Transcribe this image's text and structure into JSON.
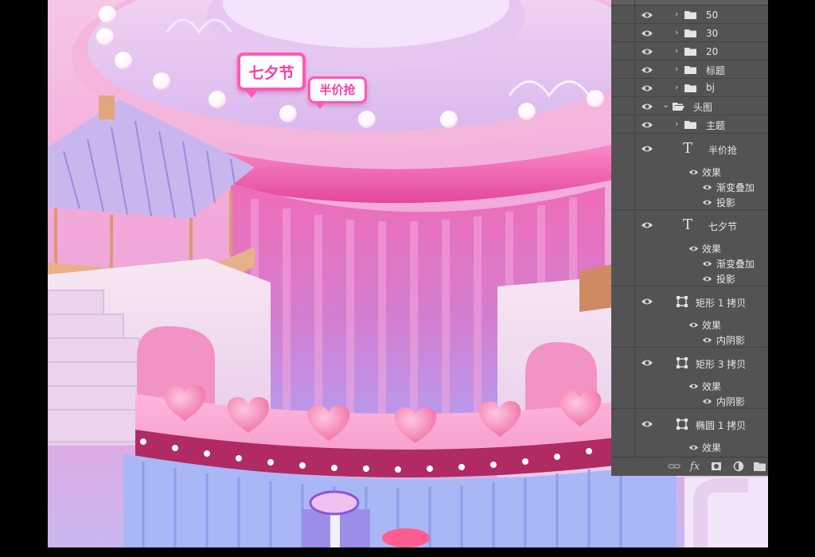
{
  "artwork": {
    "badge_qixi": "七夕节",
    "badge_half_price": "半价抢"
  },
  "layers_panel": {
    "layers": [
      {
        "name": "50",
        "kind": "group",
        "visible": true,
        "collapsed": true
      },
      {
        "name": "30",
        "kind": "group",
        "visible": true,
        "collapsed": true
      },
      {
        "name": "20",
        "kind": "group",
        "visible": true,
        "collapsed": true
      },
      {
        "name": "标题",
        "kind": "group",
        "visible": true,
        "collapsed": true
      },
      {
        "name": "bj",
        "kind": "group",
        "visible": true,
        "collapsed": true
      },
      {
        "name": "头图",
        "kind": "group",
        "visible": true,
        "collapsed": false
      },
      {
        "name": "主题",
        "kind": "group",
        "visible": true,
        "collapsed": true
      },
      {
        "name": "半价抢",
        "kind": "text",
        "visible": true,
        "effects_label": "效果",
        "effects": [
          "渐变叠加",
          "投影"
        ]
      },
      {
        "name": "七夕节",
        "kind": "text",
        "visible": true,
        "effects_label": "效果",
        "effects": [
          "渐变叠加",
          "投影"
        ]
      },
      {
        "name": "矩形 1 拷贝",
        "kind": "shape",
        "visible": true,
        "effects_label": "效果",
        "effects": [
          "内阴影"
        ]
      },
      {
        "name": "矩形 3 拷贝",
        "kind": "shape",
        "visible": true,
        "effects_label": "效果",
        "effects": [
          "内阴影"
        ]
      },
      {
        "name": "椭圆 1 拷贝",
        "kind": "shape",
        "visible": true,
        "effects_label": "效果",
        "effects": []
      }
    ],
    "bottom_icons": [
      "link-icon",
      "fx-icon",
      "mask-icon",
      "adjustment-icon",
      "new-group-icon"
    ],
    "fx_label": "fx"
  },
  "colors": {
    "panel_bg": "#535353",
    "accent_pink": "#ff3aa5"
  }
}
